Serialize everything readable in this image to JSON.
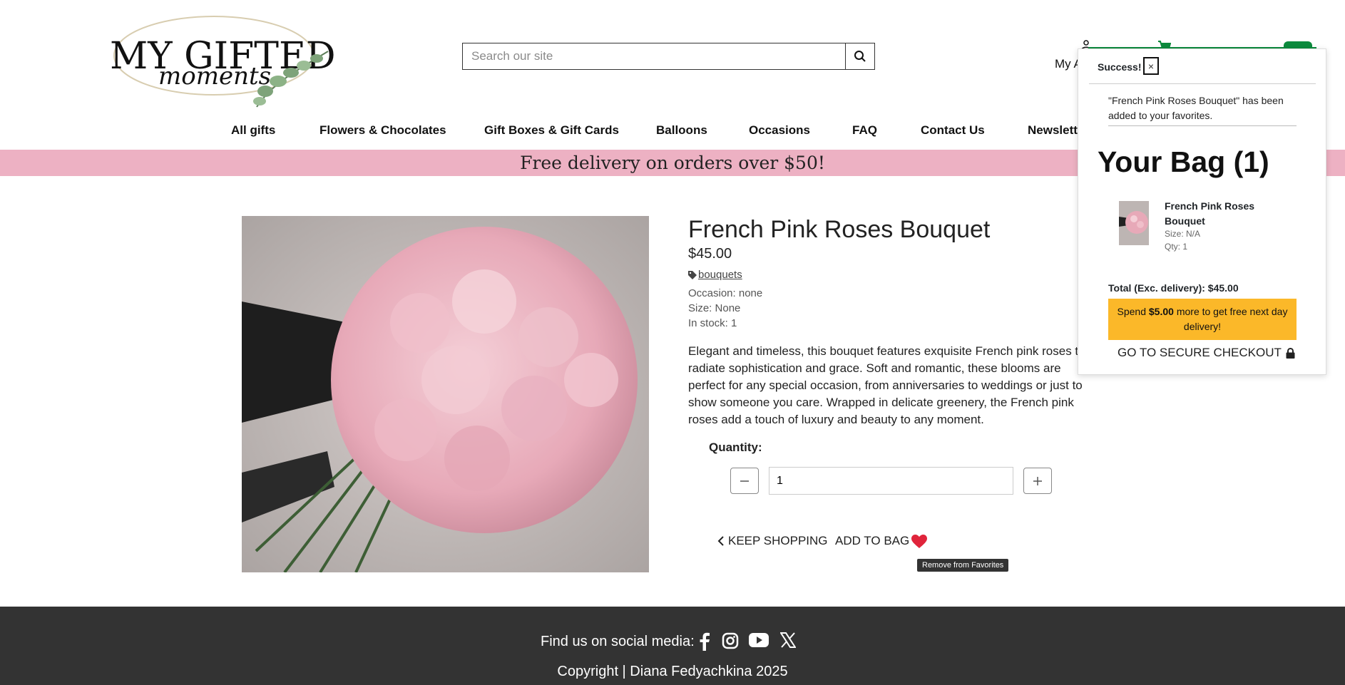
{
  "brand": {
    "logo_line1": "MY GIFTED",
    "logo_line2": "moments"
  },
  "search": {
    "placeholder": "Search our site"
  },
  "header": {
    "account_label": "My Ac"
  },
  "nav": {
    "items": [
      "All gifts",
      "Flowers & Chocolates",
      "Gift Boxes & Gift Cards",
      "Balloons",
      "Occasions",
      "FAQ",
      "Contact Us",
      "Newsletter"
    ]
  },
  "banner": {
    "text": "Free delivery on orders over $50!"
  },
  "product": {
    "title": "French Pink Roses Bouquet",
    "price": "$45.00",
    "tag": "bouquets",
    "occasion": "Occasion: none",
    "size": "Size: None",
    "stock": "In stock: 1",
    "description": "Elegant and timeless, this bouquet features exquisite French pink roses that radiate sophistication and grace. Soft and romantic, these blooms are perfect for any special occasion, from anniversaries to weddings or just to show someone you care. Wrapped in delicate greenery, the French pink roses add a touch of luxury and beauty to any moment.",
    "quantity_label": "Quantity:",
    "quantity_value": "1",
    "keep_shopping": "KEEP SHOPPING",
    "add_to_bag": "ADD TO BAG",
    "favorite_tooltip": "Remove from Favorites"
  },
  "popup": {
    "success": "Success!",
    "close": "×",
    "message": "\"French Pink Roses Bouquet\" has been added to your favorites.",
    "bag_title": "Your Bag (1)",
    "item_name": "French Pink Roses Bouquet",
    "item_size": "Size: N/A",
    "item_qty": "Qty: 1",
    "total_label": "Total (Exc. delivery): $45.00",
    "promo_pre": "Spend ",
    "promo_amount": "$5.00",
    "promo_post": " more to get free next day delivery!",
    "checkout": "GO TO SECURE CHECKOUT"
  },
  "footer": {
    "social_label": "Find us on social media:",
    "social_icons": [
      "facebook-icon",
      "instagram-icon",
      "youtube-icon",
      "x-icon"
    ],
    "copyright": "Copyright | Diana Fedyachkina 2025"
  },
  "colors": {
    "banner": "#edb1c3",
    "footer": "#333333",
    "accent_green": "#0c8a3d",
    "promo": "#fbb829",
    "heart": "#e0243b"
  }
}
